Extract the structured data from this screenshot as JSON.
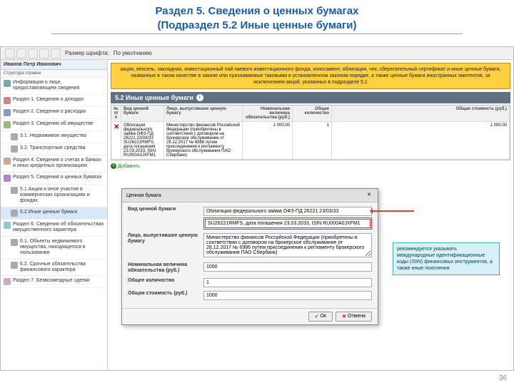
{
  "slide": {
    "title_line1": "Раздел 5. Сведения о ценных бумагах",
    "title_line2": "(Подраздел 5.2 Иные ценные бумаги)",
    "page_number": "36"
  },
  "toolbar": {
    "font_size_label": "Размер шрифта:",
    "font_size_value": "По умолчанию"
  },
  "sidebar": {
    "person": "Иванов Петр Иванович",
    "subtitle": "Структура справки",
    "items": [
      {
        "label": "Информация о лице, предоставляющем сведения",
        "color": "#7aa"
      },
      {
        "label": "Раздел 1. Сведения о доходах",
        "color": "#c88"
      },
      {
        "label": "Раздел 2. Сведения о расходах",
        "color": "#89c"
      },
      {
        "label": "Раздел 3. Сведения об имуществе",
        "color": "#9b7"
      },
      {
        "label": "3.1. Недвижимое имущество",
        "color": "#aaa",
        "sub": true
      },
      {
        "label": "3.2. Транспортные средства",
        "color": "#aaa",
        "sub": true
      },
      {
        "label": "Раздел 4. Сведения о счетах в банках и иных кредитных организациях",
        "color": "#ca8"
      },
      {
        "label": "Раздел 5. Сведения о ценных бумагах",
        "color": "#a8c"
      },
      {
        "label": "5.1 Акции и иное участие в коммерческих организациях и фондах",
        "color": "#aaa",
        "sub": true
      },
      {
        "label": "5.2 Иные ценные бумаги",
        "color": "#aaa",
        "sub": true,
        "selected": true
      },
      {
        "label": "Раздел 6. Сведения об обязательствах имущественного характера",
        "color": "#8cc"
      },
      {
        "label": "6.1. Объекты недвижимого имущества, находящегося в пользовании",
        "color": "#aaa",
        "sub": true
      },
      {
        "label": "6.2. Срочные обязательства финансового характера",
        "color": "#aaa",
        "sub": true
      },
      {
        "label": "Раздел 7. Безвозмездные сделки",
        "color": "#cac"
      }
    ]
  },
  "banner": "акция, вексель, закладная, инвестиционный пай паевого инвестиционного фонда, коносамент, облигация, чек, сберегательный сертификат и иные ценные бумаги, названные в таком качестве в законе или признаваемые таковыми в установленном законом порядке, а также ценные бумаги иностранных эмитентов, за исключением акций, указанных в подразделе 5.1",
  "section": {
    "title": "5.2 Иные ценные бумаги"
  },
  "table": {
    "headers": [
      "№ п/п",
      "Вид ценной бумаги",
      "Лицо, выпустившее ценную бумагу",
      "Номинальная величина обязательства (руб.)",
      "Общее количество",
      "Общая стоимость (руб.)"
    ],
    "row": {
      "num": "1",
      "type": "Облигация федерального займа ОФЗ-ПД 26221 23/03/33 SU26221RMFS, дата погашения 23.03.2033, ISIN RU000A0JXFM1",
      "issuer": "Министерство финансов Российской Федерации (приобретены в соответствии с договором на брокерское обслуживание от 28.12.2017 № 6986 путем присоединения к регламенту брокерского обслуживания ПАО Сбербанк)",
      "nominal": "1 000,00",
      "qty": "1",
      "total": "1 000,00"
    }
  },
  "add_label": "Добавить",
  "dialog": {
    "title": "Ценная бумага",
    "fields": {
      "type_label": "Вид ценной бумаги",
      "type_val1": "Облигация федерального займа ОФЗ-ПД 26221 23/03/33",
      "type_val2": "SU26221RMFS, дата погашения 23.03.2033, ISIN RU000A0JXFM1",
      "issuer_label": "Лицо, выпустившее ценную бумагу",
      "issuer_val": "Министерство финансов Российской Федерации (приобретены в соответствии с договором на брокерское обслуживание от 28.12.2017 № 6986 путем присоединения к регламенту брокерского обслуживания ПАО Сбербанк)",
      "nominal_label": "Номинальная величина обязательства (руб.)",
      "nominal_val": "1000",
      "qty_label": "Общее количество",
      "qty_val": "1",
      "total_label": "Общая стоимость (руб.)",
      "total_val": "1000"
    },
    "ok": "Ок",
    "cancel": "Отмена"
  },
  "callout": "рекомендуется указывать международные идентификационные коды (ISIN) финансовых инструментов, а также иные пояснения"
}
